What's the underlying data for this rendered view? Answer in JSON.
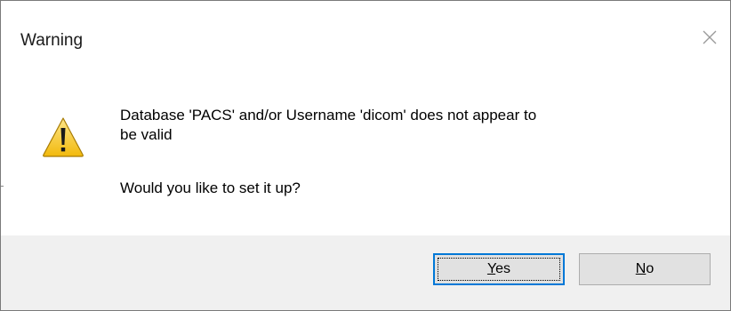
{
  "dialog": {
    "title": "Warning",
    "close_icon": "close-icon",
    "icon": "warning-triangle-icon",
    "message_line1": "Database 'PACS' and/or Username 'dicom' does not appear to",
    "message_line2": "be valid",
    "question": "Would you like to set it up?",
    "buttons": {
      "yes": {
        "accel": "Y",
        "rest": "es"
      },
      "no": {
        "accel": "N",
        "rest": "o"
      }
    }
  },
  "colors": {
    "footer_bg": "#f0f0f0",
    "button_bg": "#e1e1e1",
    "focus_border": "#0078d7",
    "warning_yellow": "#f6c90e"
  }
}
